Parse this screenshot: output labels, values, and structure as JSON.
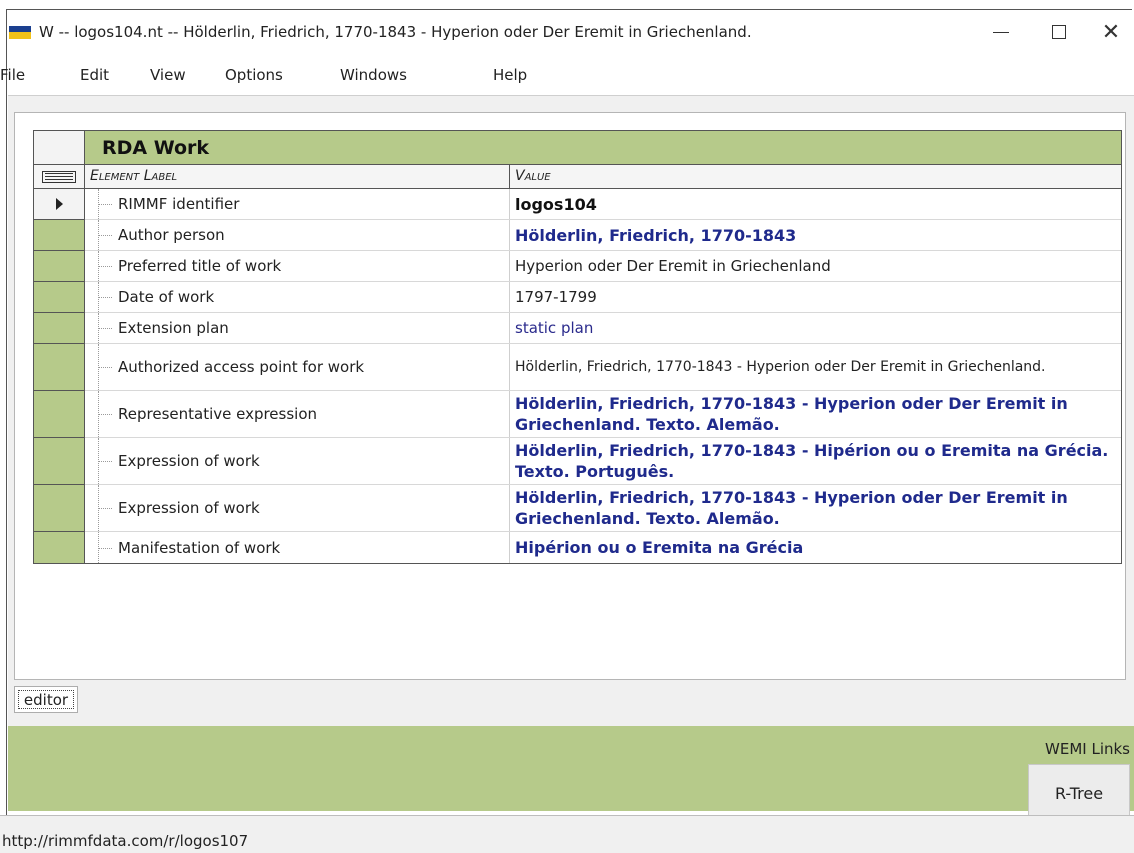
{
  "window": {
    "title": "W -- logos104.nt -- Hölderlin, Friedrich, 1770-1843 - Hyperion oder Der Eremit in Griechenland.",
    "controls": {
      "minimize": "minimize",
      "maximize": "maximize",
      "close": "✕"
    }
  },
  "menu": [
    "File",
    "Edit",
    "View",
    "Options",
    "Windows",
    "Help"
  ],
  "grid": {
    "title": "RDA Work",
    "headers": {
      "label": "Element Label",
      "value": "Value"
    },
    "rows": [
      {
        "label": "RIMMF identifier",
        "value": "logos104",
        "style": "bold",
        "current": true
      },
      {
        "label": "Author person",
        "value": "Hölderlin, Friedrich, 1770-1843",
        "style": "link"
      },
      {
        "label": "Preferred title of work",
        "value": "Hyperion oder Der Eremit in Griechenland",
        "style": "plain"
      },
      {
        "label": "Date of work",
        "value": "1797-1799",
        "style": "plain"
      },
      {
        "label": "Extension plan",
        "value": "static plan",
        "style": "plainlink"
      },
      {
        "label": "Authorized access point for work",
        "value": "Hölderlin, Friedrich, 1770-1843 - Hyperion oder Der Eremit in Griechenland.",
        "style": "small"
      },
      {
        "label": "Representative expression",
        "value": "Hölderlin, Friedrich, 1770-1843 - Hyperion oder Der Eremit in Griechenland. Texto. Alemão.",
        "style": "link2"
      },
      {
        "label": "Expression of work",
        "value": "Hölderlin, Friedrich, 1770-1843 - Hipérion ou o Eremita na Grécia. Texto. Português.",
        "style": "link2"
      },
      {
        "label": "Expression of work",
        "value": "Hölderlin, Friedrich, 1770-1843 - Hyperion oder Der Eremit in Griechenland. Texto. Alemão.",
        "style": "link2"
      },
      {
        "label": "Manifestation of work",
        "value": "Hipérion ou o Eremita na Grécia",
        "style": "link"
      }
    ]
  },
  "tabs": [
    "editor"
  ],
  "wemi": {
    "label": "WEMI Links",
    "rtree_button": "R-Tree"
  },
  "status": {
    "url": "http://rimmfdata.com/r/logos107"
  },
  "colors": {
    "accent_green": "#b6ca8a",
    "link_blue": "#1f2a8c",
    "icon_blue": "#1b3f8f",
    "icon_yellow": "#f2c21a"
  }
}
